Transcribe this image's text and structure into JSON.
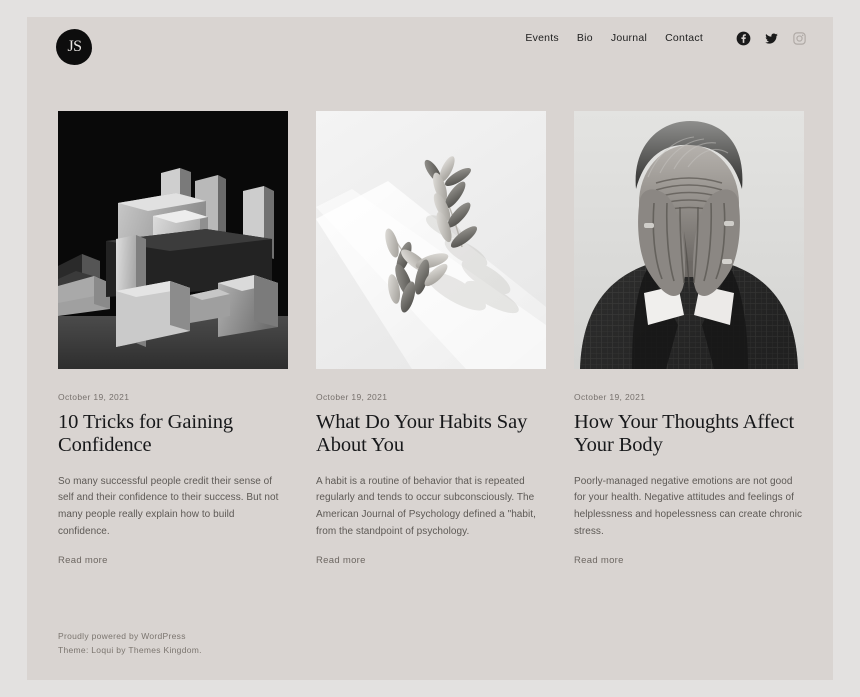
{
  "site": {
    "logo_text": "JS",
    "logo_name": "js-monogram"
  },
  "header": {
    "nav": [
      {
        "label": "Events"
      },
      {
        "label": "Bio"
      },
      {
        "label": "Journal"
      },
      {
        "label": "Contact"
      }
    ],
    "social": [
      {
        "name": "facebook-icon",
        "label": "Facebook"
      },
      {
        "name": "twitter-icon",
        "label": "Twitter"
      },
      {
        "name": "instagram-icon",
        "label": "Instagram"
      }
    ]
  },
  "posts": [
    {
      "date": "October 19, 2021",
      "title": "10 Tricks for Gaining Confidence",
      "excerpt": "So many successful people credit their sense of self and their confidence to their success. But not many people really explain how to build confidence.",
      "read_more": "Read more",
      "image_alt": "Dark abstract composition of white geometric cubes on black background"
    },
    {
      "date": "October 19, 2021",
      "title": "What Do Your Habits Say About You",
      "excerpt": "A habit is a routine of behavior that is repeated regularly and tends to occur subconsciously. The American Journal of Psychology defined a \"habit, from the standpoint of psychology.",
      "read_more": "Read more",
      "image_alt": "Minimal still life of a dried leafy branch casting a long shadow on white"
    },
    {
      "date": "October 19, 2021",
      "title": "How Your Thoughts Affect Your Body",
      "excerpt": "Poorly-managed negative emotions are not good for your health. Negative attitudes and feelings of helplessness and hopelessness can create chronic stress.",
      "read_more": "Read more",
      "image_alt": "Black and white portrait of a man in a checked suit covering his face with both hands"
    }
  ],
  "footer": {
    "line1": "Proudly powered by WordPress",
    "line2": "Theme: Loqui by Themes Kingdom."
  },
  "colors": {
    "outer_background": "#e3e1e0",
    "page_background": "#d9d4d1",
    "text_primary": "#17181a",
    "text_muted": "#77716d",
    "logo_background": "#0d0d0d"
  }
}
